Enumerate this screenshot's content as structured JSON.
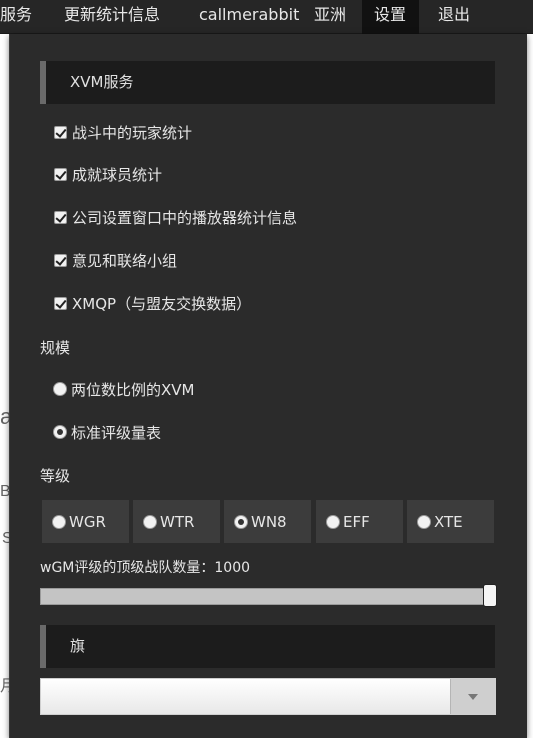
{
  "nav": {
    "items": [
      {
        "label": "服务",
        "active": false
      },
      {
        "label": "更新统计信息",
        "active": false
      },
      {
        "label": "callmerabbit",
        "active": false
      },
      {
        "label": "亚洲",
        "active": false
      },
      {
        "label": "设置",
        "active": true
      },
      {
        "label": "退出",
        "active": false
      }
    ]
  },
  "background": {
    "frag1": "a",
    "frag2": "Bu",
    "frag3": "S",
    "frag4": "月"
  },
  "xvm_section": {
    "title": "XVM服务",
    "options": [
      {
        "label": "战斗中的玩家统计",
        "checked": true
      },
      {
        "label": "成就球员统计",
        "checked": true
      },
      {
        "label": "公司设置窗口中的播放器统计信息",
        "checked": true
      },
      {
        "label": "意见和联络小组",
        "checked": true
      },
      {
        "label": "XMQP（与盟友交换数据）",
        "checked": true
      }
    ]
  },
  "scale": {
    "label": "规模",
    "options": [
      {
        "label": "两位数比例的XVM",
        "checked": false
      },
      {
        "label": "标准评级量表",
        "checked": true
      }
    ]
  },
  "level": {
    "label": "等级",
    "options": [
      {
        "label": "WGR",
        "checked": false
      },
      {
        "label": "WTR",
        "checked": false
      },
      {
        "label": "WN8",
        "checked": true
      },
      {
        "label": "EFF",
        "checked": false
      },
      {
        "label": "XTE",
        "checked": false
      }
    ]
  },
  "slider": {
    "label": "wGM评级的顶级战队数量：1000",
    "value": 1000,
    "fraction": 1.0
  },
  "flag_section": {
    "title": "旗",
    "dropdown_value": ""
  }
}
